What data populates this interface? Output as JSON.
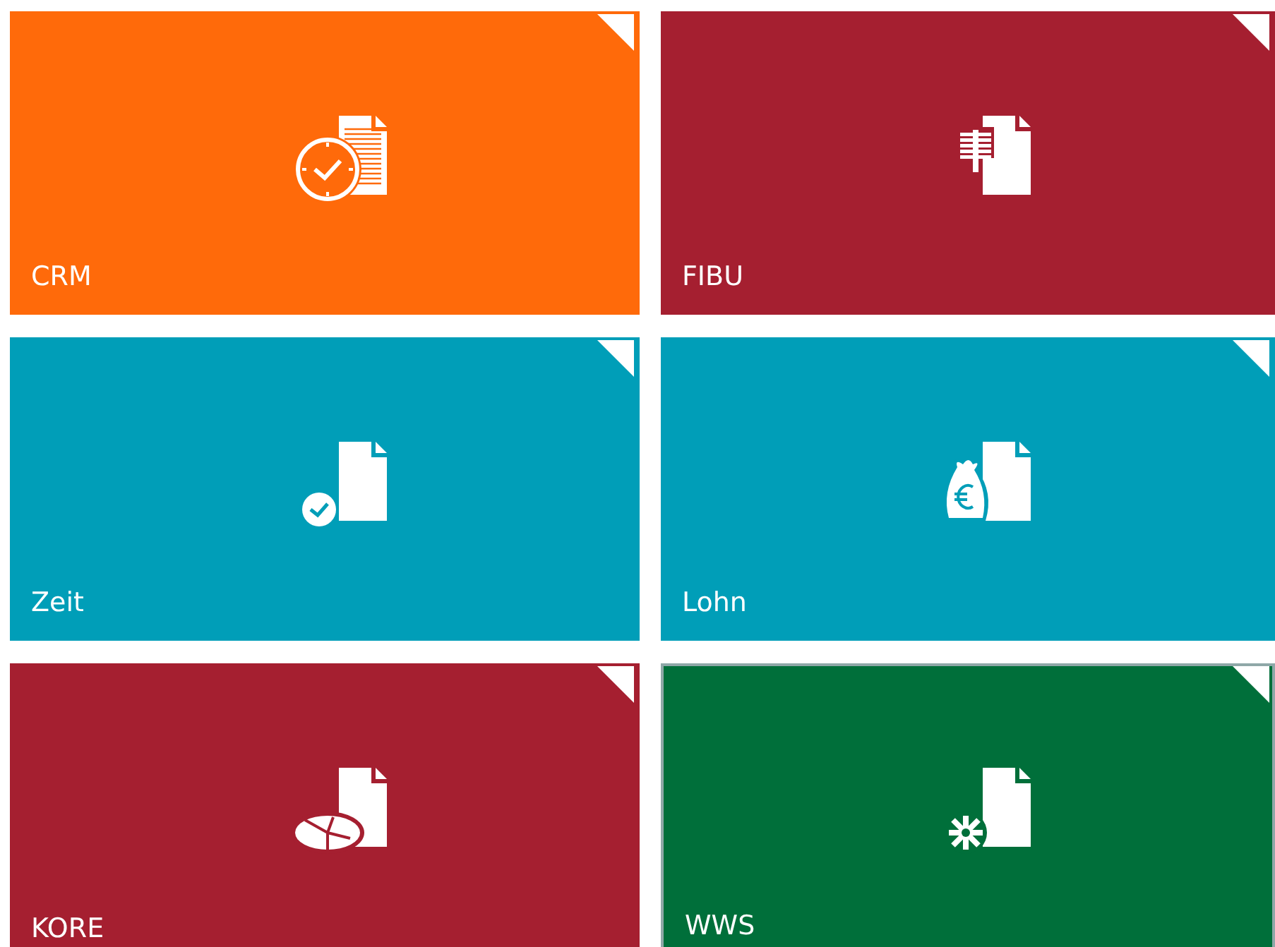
{
  "tiles": [
    {
      "label": "CRM",
      "color": "#ff6a0a",
      "kind": "clock",
      "selected": false
    },
    {
      "label": "FIBU",
      "color": "#a51f30",
      "kind": "ledger",
      "selected": false
    },
    {
      "label": "Zeit",
      "color": "#009eb8",
      "kind": "check",
      "selected": false
    },
    {
      "label": "Lohn",
      "color": "#009eb8",
      "kind": "moneybag",
      "selected": false
    },
    {
      "label": "KORE",
      "color": "#a51f30",
      "kind": "pie",
      "selected": false
    },
    {
      "label": "WWS",
      "color": "#006f3a",
      "kind": "gear",
      "selected": true
    }
  ]
}
